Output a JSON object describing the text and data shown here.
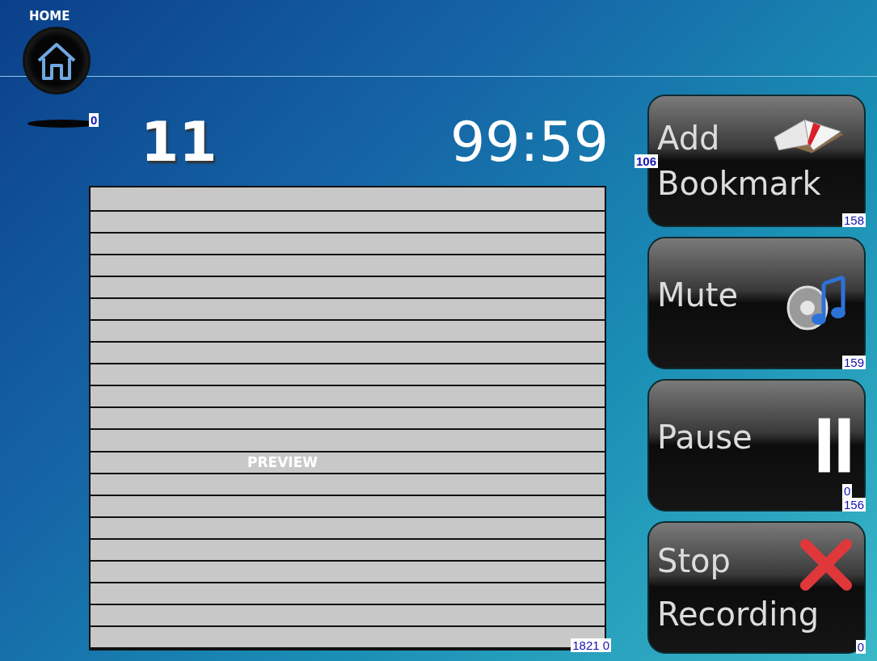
{
  "home": {
    "label": "HOME",
    "tag": "0"
  },
  "counter": "11",
  "timer": "99:59",
  "preview": {
    "label": "PREVIEW",
    "tags": [
      "1821",
      "0"
    ]
  },
  "buttons": [
    {
      "label": "Add Bookmark",
      "kind": "bookmark",
      "side_tag": "106",
      "corner_tags": [
        "158"
      ]
    },
    {
      "label": "Mute",
      "kind": "mute",
      "corner_tags": [
        "159"
      ]
    },
    {
      "label": "Pause",
      "kind": "pause",
      "corner_tags": [
        "0",
        "156"
      ]
    },
    {
      "label": "Stop Recording",
      "kind": "stop",
      "corner_tags": [
        "0"
      ]
    }
  ]
}
